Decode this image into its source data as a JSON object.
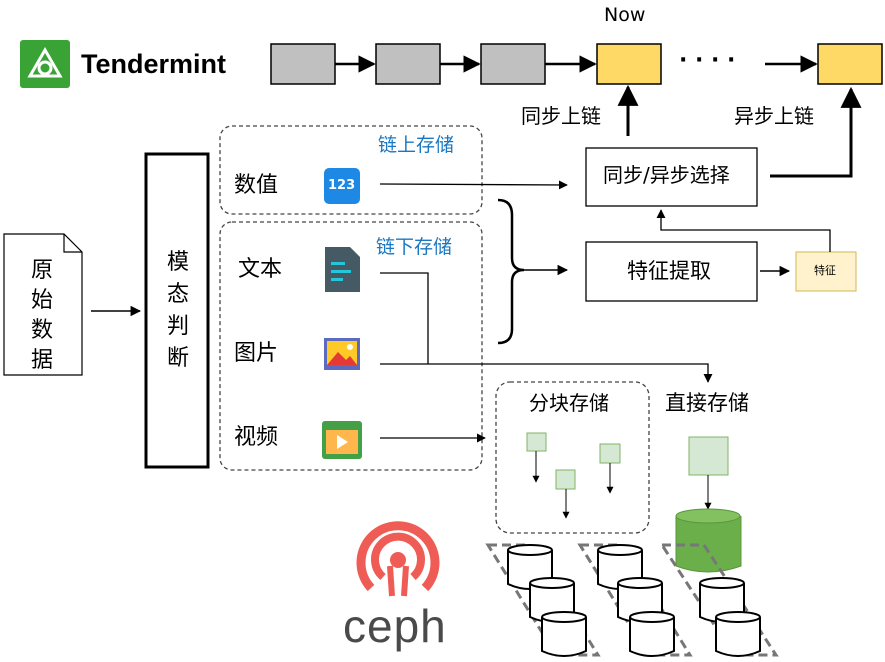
{
  "brand": {
    "tendermint": "Tendermint",
    "ceph": "ceph"
  },
  "chain": {
    "now_label": "Now",
    "ellipsis": "· · · ·"
  },
  "labels": {
    "sync_chain": "同步上链",
    "async_chain": "异步上链",
    "on_chain_storage": "链上存储",
    "off_chain_storage": "链下存储",
    "numeric": "数值",
    "text": "文本",
    "image": "图片",
    "video": "视频",
    "block_storage": "分块存储",
    "direct_storage": "直接存储",
    "numeric_icon_text": "123"
  },
  "nodes": {
    "raw_data": [
      "原",
      "始",
      "数",
      "据"
    ],
    "modality": [
      "模",
      "态",
      "判",
      "断"
    ],
    "sync_async_select": "同步/异步选择",
    "feature_extract": "特征提取",
    "feature": "特征"
  },
  "colors": {
    "chain_block_gray": "#c0c0c0",
    "chain_block_yellow": "#ffd966",
    "feature_box_fill": "#fff2cc",
    "feature_box_stroke": "#d6b656",
    "storage_block_fill": "#d5e8d4",
    "storage_block_stroke": "#82b366",
    "green_cylinder": "#6aaf4a",
    "ceph_red": "#ef5c55",
    "tendermint_green": "#3aa335",
    "link_blue": "#1a78c2"
  }
}
